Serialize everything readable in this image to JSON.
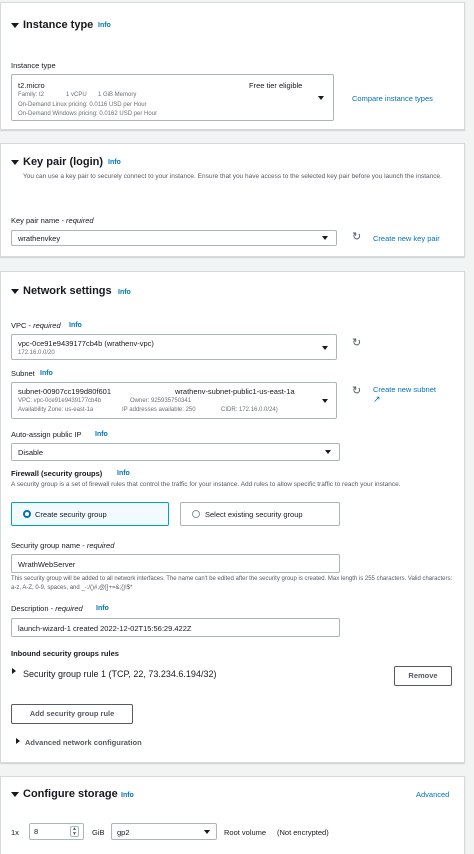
{
  "instance_type": {
    "title": "Instance type",
    "info": "Info",
    "field_label": "Instance type",
    "selected": "t2.micro",
    "free_tier": "Free tier eligible",
    "family": "Family: t2",
    "vcpu": "1 vCPU",
    "memory": "1 GiB Memory",
    "linux_pricing": "On-Demand Linux pricing: 0.0116 USD per Hour",
    "windows_pricing": "On-Demand Windows pricing: 0.0162 USD per Hour",
    "compare_link": "Compare instance types"
  },
  "key_pair": {
    "title": "Key pair (login)",
    "info": "Info",
    "description": "You can use a key pair to securely connect to your instance. Ensure that you have access to the selected key pair before you launch the instance.",
    "field_label": "Key pair name - ",
    "required": "required",
    "selected": "wrathenvkey",
    "create_link": "Create new key pair"
  },
  "network": {
    "title": "Network settings",
    "info": "Info",
    "vpc_label": "VPC - ",
    "required": "required",
    "vpc_info": "Info",
    "vpc_value": "vpc-0ce91e9439177cb4b (wrathenv-vpc)",
    "vpc_cidr": "172.16.0.0/20",
    "subnet_label": "Subnet",
    "subnet_info": "Info",
    "subnet_id": "subnet-00907cc199d80f601",
    "subnet_name": "wrathenv-subnet-public1-us-east-1a",
    "subnet_vpc": "VPC: vpc-0ce91e9439177cb4b",
    "subnet_owner": "Owner: 925935750341",
    "subnet_az": "Availability Zone: us-east-1a",
    "subnet_ips": "IP addresses available: 250",
    "subnet_cidr": "CIDR: 172.16.0.0/24)",
    "create_subnet_link": "Create new subnet",
    "auto_ip_label": "Auto-assign public IP",
    "auto_ip_info": "Info",
    "auto_ip_value": "Disable",
    "firewall_label": "Firewall (security groups)",
    "firewall_info": "Info",
    "firewall_desc": "A security group is a set of firewall rules that control the traffic for your instance. Add rules to allow specific traffic to reach your instance.",
    "create_sg": "Create security group",
    "select_sg": "Select existing security group",
    "sg_name_label": "Security group name - ",
    "sg_name_value": "WrathWebServer",
    "sg_name_help": "This security group will be added to all network interfaces. The name can't be edited after the security group is created. Max length is 255 characters. Valid characters: a-z, A-Z, 0-9, spaces, and _-:/()#,@[]+=&;{}!$*",
    "desc_label": "Description - ",
    "desc_info": "Info",
    "desc_value": "launch-wizard-1 created 2022-12-02T15:56:29.422Z",
    "inbound_label": "Inbound security groups rules",
    "rule_label": "Security group rule 1 (TCP, 22, 73.234.6.194/32)",
    "remove_button": "Remove",
    "add_rule_button": "Add security group rule",
    "advanced_label": "Advanced network configuration"
  },
  "storage": {
    "title": "Configure storage",
    "info": "Info",
    "advanced_link": "Advanced",
    "multiplier": "1x",
    "size": "8",
    "unit": "GiB",
    "volume_type": "gp2",
    "root_label": "Root volume",
    "encryption": "(Not encrypted)"
  }
}
